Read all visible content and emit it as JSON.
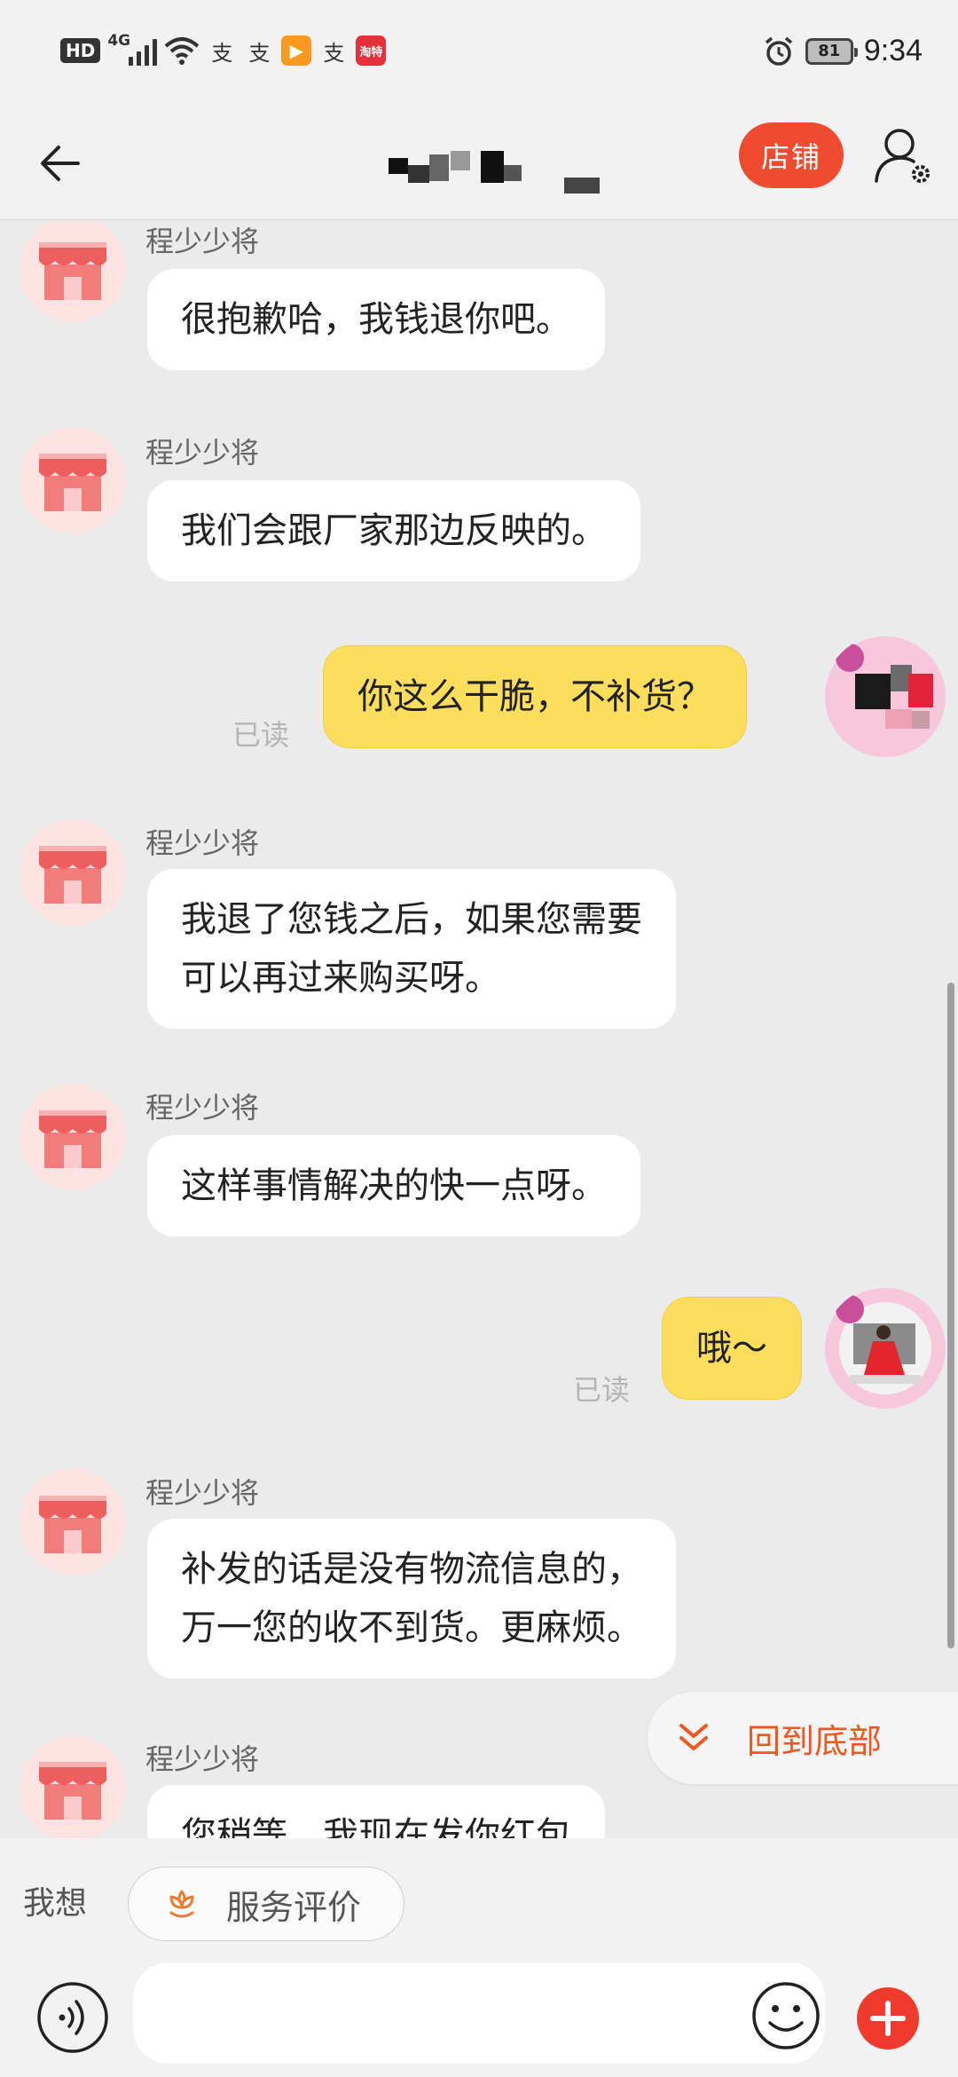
{
  "status_bar": {
    "hd": "HD",
    "network": "4G",
    "app_glyph_1": "支",
    "app_glyph_2": "支",
    "app_glyph_3": "▶",
    "app_glyph_4": "支",
    "app_glyph_5": "淘特",
    "battery": "81",
    "time": "9:34"
  },
  "header": {
    "shop_button": "店铺"
  },
  "messages": [
    {
      "sender": "程少少将",
      "text": "很抱歉哈，我钱退你吧。"
    },
    {
      "sender": "程少少将",
      "text": "我们会跟厂家那边反映的。"
    },
    {
      "text": "你这么干脆，不补货？",
      "read": "已读"
    },
    {
      "sender": "程少少将",
      "line1": "我退了您钱之后，如果您需要",
      "line2": "可以再过来购买呀。"
    },
    {
      "sender": "程少少将",
      "text": "这样事情解决的快一点呀。"
    },
    {
      "text": "哦～",
      "read": "已读"
    },
    {
      "sender": "程少少将",
      "line1": "补发的话是没有物流信息的，",
      "line2": "万一您的收不到货。更麻烦。"
    },
    {
      "sender": "程少少将",
      "text": "您稍等，我现在发你红包"
    }
  ],
  "back_to_bottom": "回到底部",
  "quick_bar": {
    "label": "我想",
    "chip": "服务评价"
  },
  "colors": {
    "accent": "#f04a2f",
    "my_bubble": "#fcde5c",
    "background": "#ebebeb"
  }
}
